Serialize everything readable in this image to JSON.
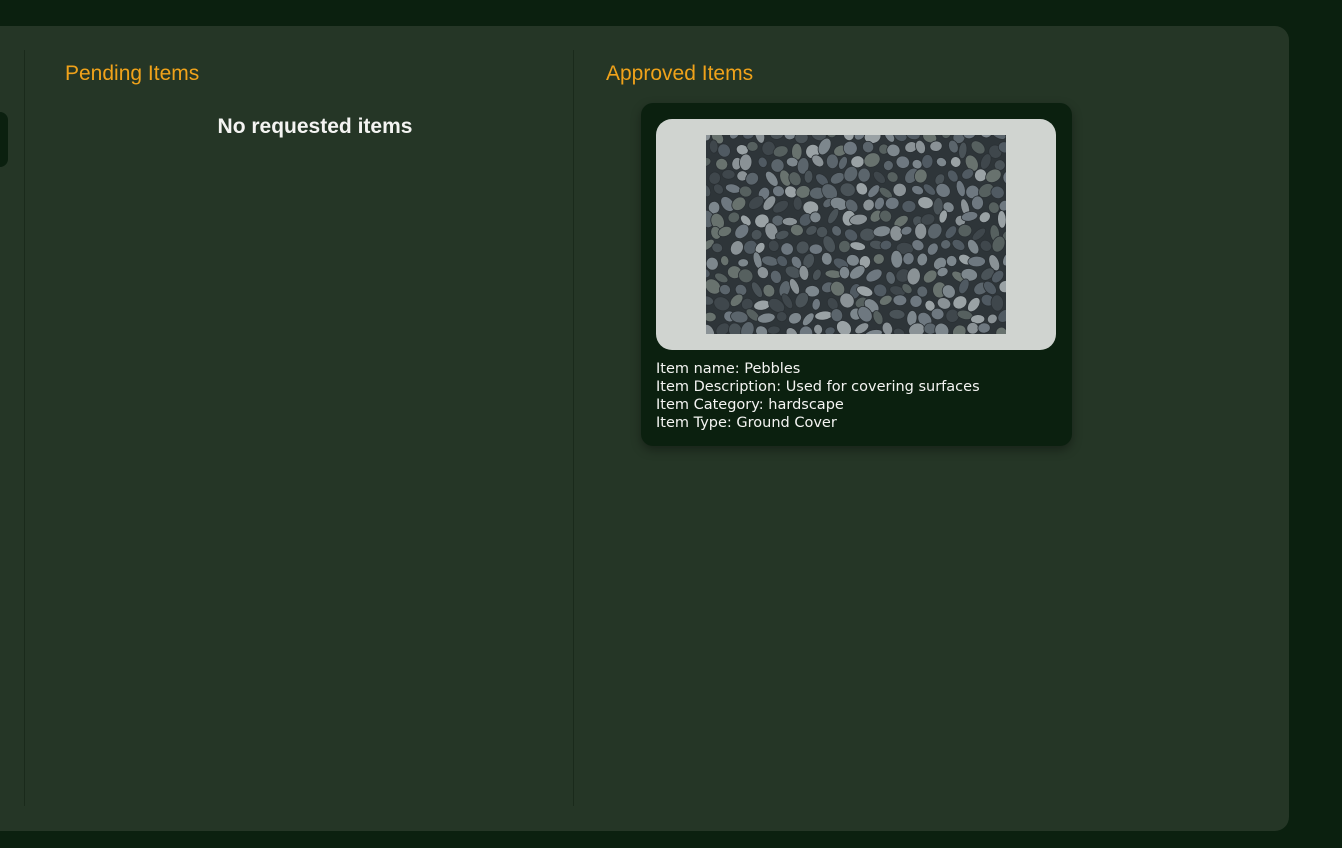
{
  "pending": {
    "title": "Pending Items",
    "empty_message": "No requested items"
  },
  "approved": {
    "title": "Approved Items",
    "items": [
      {
        "image_alt": "Pebbles",
        "name_line": "Item name: Pebbles",
        "description_line": "Item Description: Used for covering surfaces",
        "category_line": "Item Category: hardscape",
        "type_line": "Item Type: Ground Cover"
      }
    ]
  },
  "colors": {
    "background": "#0b200f",
    "panel": "#253626",
    "accent": "#f0a21a",
    "text": "#f4f4f2",
    "card": "#0b200f"
  }
}
